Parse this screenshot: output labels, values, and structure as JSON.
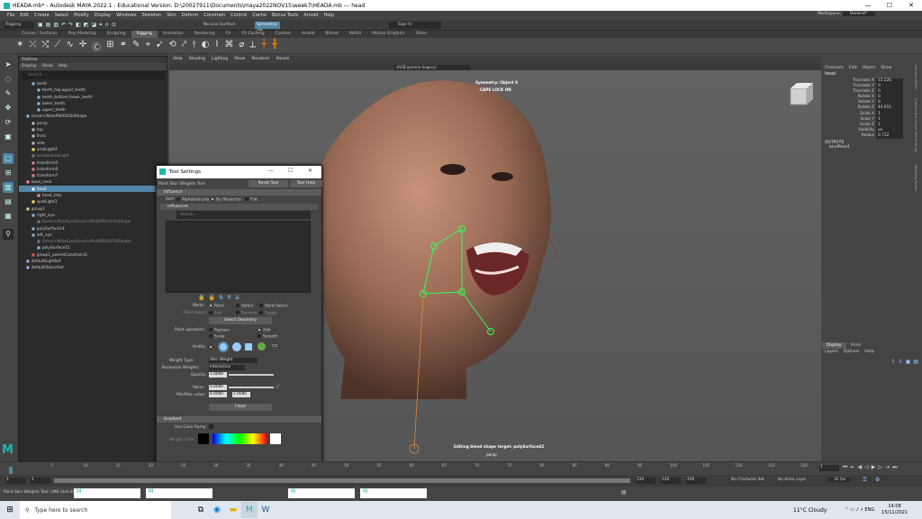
{
  "window": {
    "title": "HEADA.mb* - Autodesk MAYA 2022.1 - Educational Version: D:\\20027911\\Documents\\maya2022NOV15\\week7\\HEADA.mb  ---  head",
    "minimize": "—",
    "maximize": "☐",
    "close": "✕"
  },
  "menubar": [
    "File",
    "Edit",
    "Create",
    "Select",
    "Modify",
    "Display",
    "Windows",
    "Skeleton",
    "Skin",
    "Deform",
    "Constrain",
    "Control",
    "Cache",
    "Bonus Tools",
    "Arnold",
    "Help"
  ],
  "workspace": {
    "label": "Workspace:",
    "value": "General*"
  },
  "statusline": {
    "mode": "Rigging",
    "live_surface": "No Live Surface",
    "symmetry": "Symmetry: Off",
    "sign_in": "Sign In"
  },
  "shelf_tabs": [
    "Curves / Surfaces",
    "Poly Modeling",
    "Sculpting",
    "Rigging",
    "Animation",
    "Rendering",
    "FX",
    "FX Caching",
    "Custom",
    "Arnold",
    "Bifrost",
    "MASH",
    "Motion Graphics",
    "XGen"
  ],
  "shelf_active": "Rigging",
  "outliner": {
    "title": "Outliner",
    "menu": [
      "Display",
      "Show",
      "Help"
    ],
    "search_placeholder": "Search...",
    "items": [
      {
        "label": "teeth",
        "indent": 1,
        "kind": "mesh"
      },
      {
        "label": "teeth_top:upper_teeth",
        "indent": 2,
        "kind": "mesh"
      },
      {
        "label": "teeth_bottom:lower_teeth",
        "indent": 2,
        "kind": "mesh"
      },
      {
        "label": "lower_teeth",
        "indent": 2,
        "kind": "mesh"
      },
      {
        "label": "upper_teeth",
        "indent": 2,
        "kind": "mesh"
      },
      {
        "label": "GenericMaleP8U01OldShape",
        "indent": 0,
        "kind": "mesh"
      },
      {
        "label": "persp",
        "indent": 1,
        "kind": "cam"
      },
      {
        "label": "top",
        "indent": 1,
        "kind": "cam"
      },
      {
        "label": "front",
        "indent": 1,
        "kind": "cam"
      },
      {
        "label": "side",
        "indent": 1,
        "kind": "cam"
      },
      {
        "label": "ambLight2",
        "indent": 1,
        "kind": "light"
      },
      {
        "label": "arnoldsomeLight",
        "indent": 1,
        "kind": "dim"
      },
      {
        "label": "transform5",
        "indent": 1,
        "kind": "xf"
      },
      {
        "label": "transform6",
        "indent": 1,
        "kind": "xf"
      },
      {
        "label": "transform7",
        "indent": 1,
        "kind": "xf"
      },
      {
        "label": "base_neck",
        "indent": 0,
        "kind": "joint"
      },
      {
        "label": "head",
        "indent": 1,
        "kind": "sel"
      },
      {
        "label": "head_tata",
        "indent": 2,
        "kind": "joint"
      },
      {
        "label": "spotLight1",
        "indent": 1,
        "kind": "light"
      },
      {
        "label": "group1",
        "indent": 0,
        "kind": "grp"
      },
      {
        "label": "right_eye",
        "indent": 1,
        "kind": "mesh"
      },
      {
        "label": "GenericMaleEyesGenericMaleP8U01OldShape",
        "indent": 2,
        "kind": "dim"
      },
      {
        "label": "polySurface14",
        "indent": 1,
        "kind": "mesh"
      },
      {
        "label": "left_eye",
        "indent": 1,
        "kind": "mesh"
      },
      {
        "label": "GenericMaleEyesGenericMaleP8U01OldShape",
        "indent": 2,
        "kind": "dim"
      },
      {
        "label": "polySurface15",
        "indent": 2,
        "kind": "mesh"
      },
      {
        "label": "group1_parentConstraint1",
        "indent": 1,
        "kind": "con"
      },
      {
        "label": "defaultLightSet",
        "indent": 0,
        "kind": "set"
      },
      {
        "label": "defaultObjectSet",
        "indent": 0,
        "kind": "set"
      }
    ]
  },
  "viewport": {
    "menu": [
      "View",
      "Shading",
      "Lighting",
      "Show",
      "Renderer",
      "Panels"
    ],
    "colorspace": "sRGB gamma (legacy)",
    "hud_top1": "Symmetry: Object X",
    "hud_top2": "CAPS LOCK ON",
    "hud_bottom1": "Editing blend shape target: polySurface42",
    "hud_bottom2": "persp"
  },
  "channel_box": {
    "menu": [
      "Channels",
      "Edit",
      "Object",
      "Show"
    ],
    "node": "head",
    "channels": [
      {
        "label": "Translate X",
        "value": "15.226"
      },
      {
        "label": "Translate Y",
        "value": "0"
      },
      {
        "label": "Translate Z",
        "value": "0"
      },
      {
        "label": "Rotate X",
        "value": "0"
      },
      {
        "label": "Rotate Y",
        "value": "0"
      },
      {
        "label": "Rotate Z",
        "value": "44.911"
      },
      {
        "label": "Scale X",
        "value": "1"
      },
      {
        "label": "Scale Y",
        "value": "1"
      },
      {
        "label": "Scale Z",
        "value": "1"
      },
      {
        "label": "Visibility",
        "value": "on"
      },
      {
        "label": "Radius",
        "value": "0.712"
      }
    ],
    "outputs_label": "OUTPUTS",
    "output_node": "bindPose1",
    "side_tabs": [
      "Attribute Editor",
      "Channel Box / Layer Editor",
      "Tool Settings",
      "Modeling Toolkit"
    ]
  },
  "layer_editor": {
    "tabs": [
      "Display",
      "Anim"
    ],
    "menu": [
      "Layers",
      "Options",
      "Help"
    ]
  },
  "tool_settings": {
    "title": "Tool Settings",
    "tool_name": "Paint Skin Weights Tool",
    "reset_label": "Reset Tool",
    "help_label": "Tool Help",
    "influence_header": "Influence",
    "sort_label": "Sort:",
    "sort_options": [
      "Alphabetically",
      "By Hierarchy",
      "Flat"
    ],
    "influences_header": "Influences",
    "search_placeholder": "Search...",
    "mode_label": "Mode:",
    "mode_options": [
      "Paint",
      "Select",
      "Paint Select"
    ],
    "paint_select_label": "Paint Select:",
    "paint_select_options": [
      "Add",
      "Remove",
      "Toggle"
    ],
    "select_geometry_label": "Select Geometry",
    "paint_op_label": "Paint operation:",
    "paint_op_options": [
      "Replace",
      "Add",
      "Scale",
      "Smooth"
    ],
    "profile_label": "Profile:",
    "weight_type_label": "Weight Type:",
    "weight_type_value": "Skin Weight",
    "normalize_label": "Normalize Weights:",
    "normalize_value": "Interactive",
    "opacity_label": "Opacity:",
    "opacity_value": "1.0000",
    "value_label": "Value:",
    "value_value": "0.0000",
    "minmax_label": "Min/Max value:",
    "min_value": "0.0000",
    "max_value": "1.0000",
    "flood_label": "Flood",
    "gradient_header": "Gradient",
    "use_color_ramp_label": "Use Color Ramp:",
    "weight_color_label": "Weight Color:"
  },
  "timeslider": {
    "ticks": [
      "5",
      "10",
      "15",
      "20",
      "25",
      "30",
      "35",
      "40",
      "45",
      "50",
      "55",
      "60",
      "65",
      "70",
      "75",
      "80",
      "85",
      "90",
      "95",
      "100",
      "105",
      "110",
      "115",
      "120"
    ],
    "current": "1",
    "start": "1",
    "end_frame": "120"
  },
  "rangeslider": {
    "start": "1",
    "range_start": "1",
    "range_end": "120",
    "anim_end": "120",
    "end": "200",
    "char_set": "No Character Set",
    "anim_layer": "No Anim Layer",
    "fps": "30 fps"
  },
  "command_line": {
    "status": "Paint Skin Weights Tool: LMB click-drag to paint...",
    "lang": "MEL",
    "mini_windows": [
      "M",
      "M",
      "M",
      "M"
    ]
  },
  "taskbar": {
    "search_placeholder": "Type here to search",
    "weather": "11°C  Cloudy",
    "time": "14:08",
    "date": "15/11/2021"
  }
}
